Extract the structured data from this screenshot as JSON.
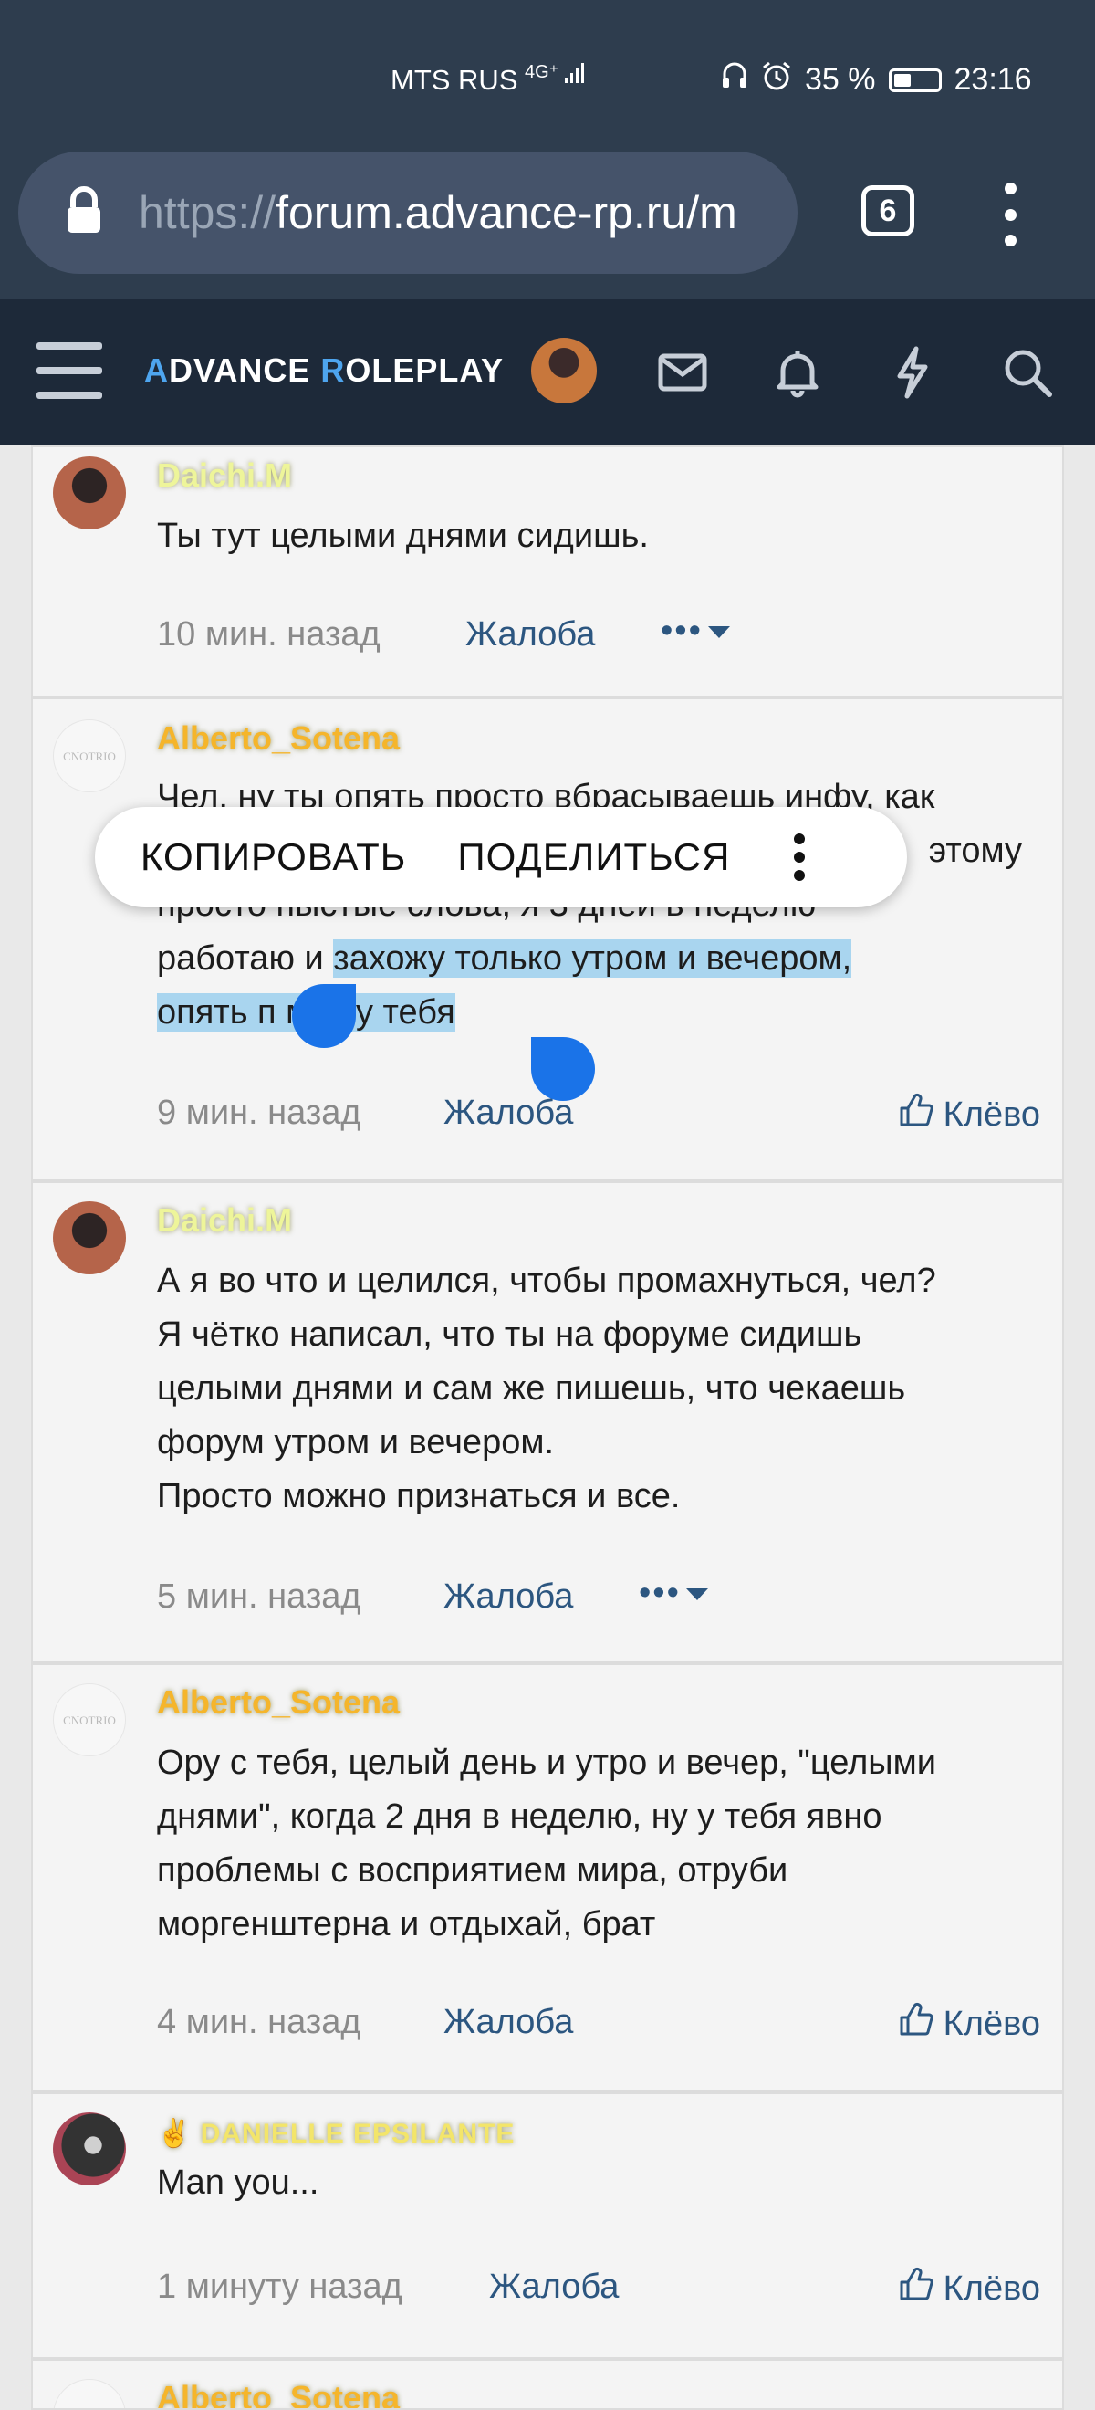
{
  "status_bar": {
    "carrier": "MTS RUS",
    "network": "4G⁺",
    "battery": "35 %",
    "time": "23:16",
    "battery_level": 0.35
  },
  "browser": {
    "url_scheme": "https://",
    "url_host": "forum.advance-rp.ru/m",
    "tab_count": "6"
  },
  "site": {
    "logo_first": "A",
    "logo_rest_1": "DVANCE ",
    "logo_r": "R",
    "logo_rest_2": "OLEPLAY"
  },
  "selection_popup": {
    "copy": "КОПИРОВАТЬ",
    "share": "ПОДЕЛИТЬСЯ"
  },
  "posts": [
    {
      "author": "Daichi.M",
      "text": "Ты тут целыми днями сидишь.",
      "time": "10 мин. назад",
      "report": "Жалоба",
      "more": "•••"
    },
    {
      "author": "Alberto_Sotena",
      "text_line1": "Чел, ну ты опять просто вбрасываешь инфу, как",
      "text_line2_tail": "этому",
      "text_line3": "просто пыстые слова, я 3 дней в неделю",
      "text_line4_start": "работаю и ",
      "text_line4_hl": "захожу только утром и вечером,",
      "text_line5_hl": "опять п    мах у тебя",
      "time": "9 мин. назад",
      "report": "Жалоба",
      "like": "Клёво"
    },
    {
      "author": "Daichi.M",
      "lines": [
        "А я во что и целился, чтобы промахнуться, чел?",
        "Я чётко написал, что ты на форуме сидишь",
        "целыми днями и сам же пишешь, что чекаешь",
        "форум утром и вечером.",
        "Просто можно признаться и все."
      ],
      "time": "5 мин. назад",
      "report": "Жалоба",
      "more": "•••"
    },
    {
      "author": "Alberto_Sotena",
      "lines": [
        "Ору с тебя, целый день и утро и вечер, \"целыми",
        "днями\", когда 2 дня в неделю, ну у тебя явно",
        "проблемы с восприятием мира, отруби",
        "моргенштерна и отдыхай, брат"
      ],
      "time": "4 мин. назад",
      "report": "Жалоба",
      "like": "Клёво"
    },
    {
      "author": "DANIELLE EPSILANTE",
      "text": "Man you...",
      "time": "1 минуту назад",
      "report": "Жалоба",
      "like": "Клёво"
    },
    {
      "author": "Alberto_Sotena"
    }
  ],
  "colors": {
    "status_bg": "#2e3d4e",
    "header_bg": "#1d2939",
    "link": "#2c5680",
    "selection": "#a9d5ef",
    "handle": "#1a73e8"
  }
}
